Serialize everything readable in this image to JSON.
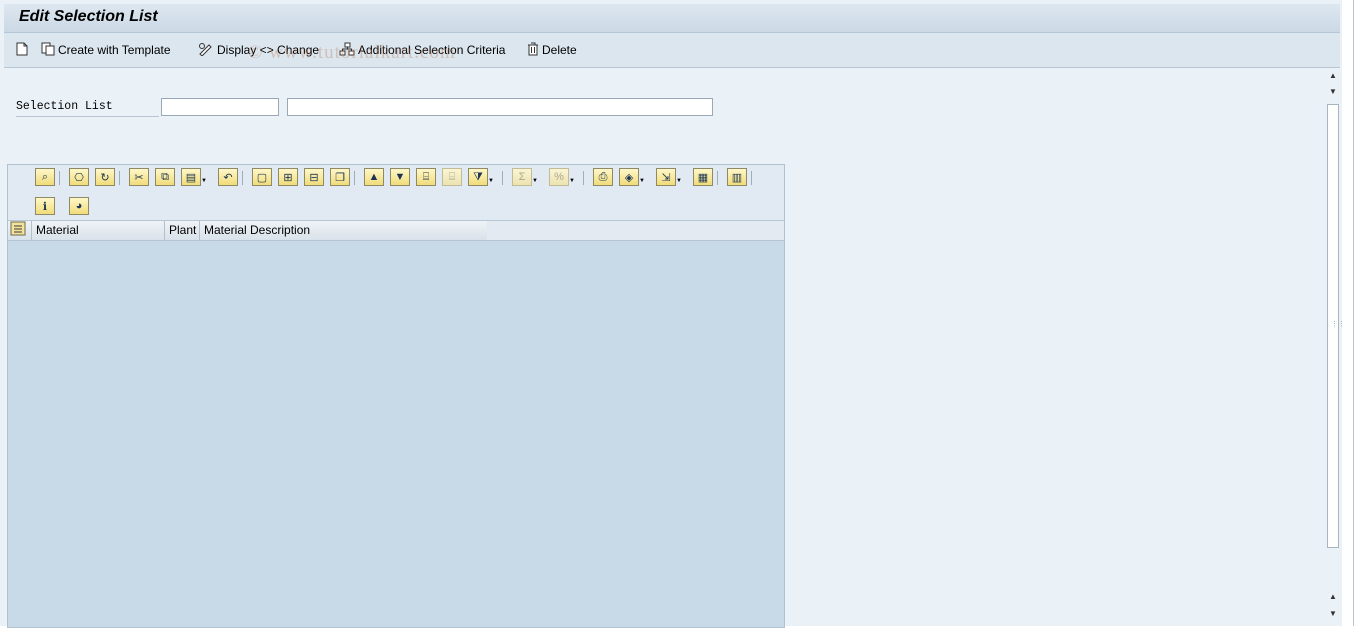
{
  "title": "Edit Selection List",
  "toolbar": {
    "create_label": "Create with Template",
    "display_change_label": "Display <> Change",
    "additional_criteria_label": "Additional Selection Criteria",
    "delete_label": "Delete"
  },
  "watermark": "© www.tutorialkart.com",
  "selection": {
    "label": "Selection List",
    "code_value": "",
    "description_value": ""
  },
  "grid": {
    "columns": [
      "Material",
      "Plant",
      "Material Description"
    ],
    "rows": []
  },
  "icons": {
    "new": "new-document-icon",
    "copy": "copy-template-icon",
    "edit": "pencil-glasses-icon",
    "criteria": "hierarchy-icon",
    "delete": "trash-icon"
  },
  "colors": {
    "background": "#eaf1f7",
    "grid_area": "#c8d9e7",
    "grid_button": "#f1dc7a"
  }
}
